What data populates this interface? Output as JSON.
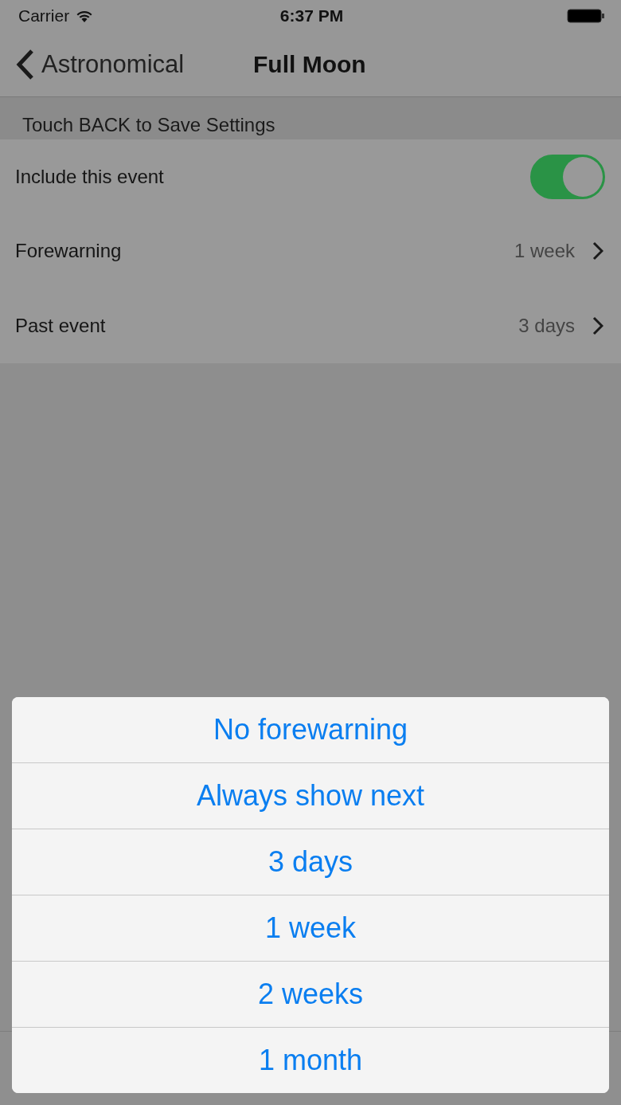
{
  "status_bar": {
    "carrier": "Carrier",
    "time": "6:37 PM"
  },
  "nav": {
    "back": "Astronomical",
    "title": "Full Moon"
  },
  "section_header": "Touch BACK to Save Settings",
  "rows": [
    {
      "kind": "switch",
      "label": "Include this event",
      "on": true
    },
    {
      "kind": "disclosure",
      "label": "Forewarning",
      "value": "1 week"
    },
    {
      "kind": "disclosure",
      "label": "Past event",
      "value": "3 days"
    }
  ],
  "action_sheet": {
    "options": [
      "No forewarning",
      "Always show next",
      "3 days",
      "1 week",
      "2 weeks",
      "1 month"
    ]
  }
}
